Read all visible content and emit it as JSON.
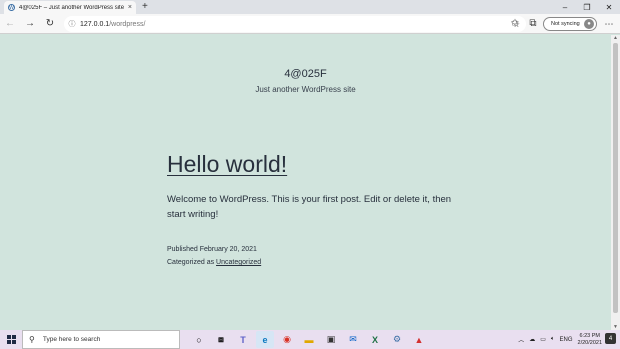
{
  "browser": {
    "tab_title": "4@025F – Just another WordPress site",
    "tab_close": "×",
    "new_tab": "+",
    "address_host": "127.0.0.1",
    "address_path": "/wordpress/",
    "sync_label": "Not syncing",
    "window_controls": [
      "–",
      "❐",
      "✕"
    ]
  },
  "site": {
    "title": "4@025F",
    "description": "Just another WordPress site"
  },
  "post": {
    "title": "Hello world!",
    "body": "Welcome to WordPress. This is your first post. Edit or delete it, then start writing!",
    "published_label": "Published February 20, 2021",
    "categorized_prefix": "Categorized as ",
    "category": "Uncategorized"
  },
  "taskbar": {
    "search_placeholder": "Type here to search",
    "language": "ENG",
    "time": "6:23 PM",
    "date": "2/20/2021",
    "notification_count": "4"
  }
}
